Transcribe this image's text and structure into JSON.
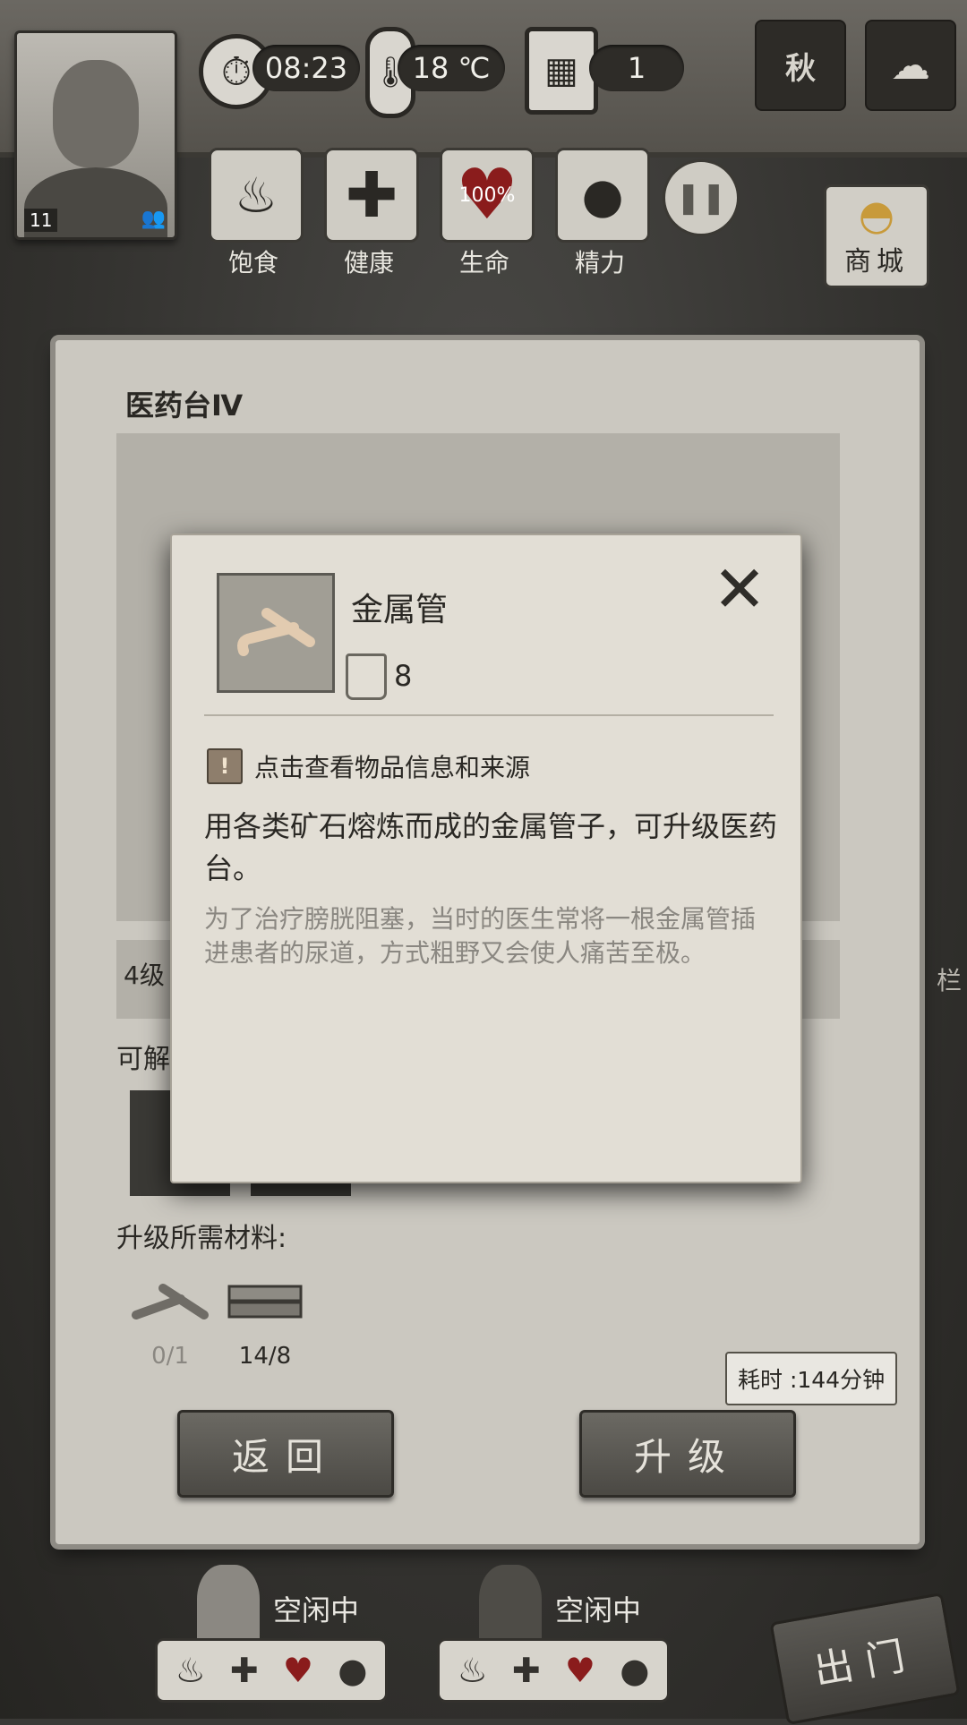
{
  "header": {
    "time": "08:23",
    "temperature": "18 ℃",
    "day": "1",
    "season": "秋",
    "portrait_level": "11"
  },
  "stats": [
    {
      "label": "饱食",
      "value": ""
    },
    {
      "label": "健康",
      "value": ""
    },
    {
      "label": "生命",
      "value": "100%"
    },
    {
      "label": "精力",
      "value": ""
    }
  ],
  "shop": {
    "label": "商城"
  },
  "panel": {
    "title": "医药台Ⅳ",
    "level_row": "4级",
    "unlock_label": "可解",
    "requirements_label": "升级所需材料:",
    "materials": [
      {
        "icon": "metal-pipe-icon",
        "qty": "0/1",
        "qty_color": "#8a8781"
      },
      {
        "icon": "wood-plank-icon",
        "qty": "14/8",
        "qty_color": "#2a2824"
      }
    ],
    "back_button": "返回",
    "upgrade_button": "升级",
    "time_cost": "耗时 :144分钟"
  },
  "dialog": {
    "item_name": "金属管",
    "item_count": "8",
    "info_link": "点击查看物品信息和来源",
    "description": "用各类矿石熔炼而成的金属管子，可升级医药台。",
    "lore": "为了治疗膀胱阻塞，当时的医生常将一根金属管插进患者的尿道，方式粗野又会使人痛苦至极。"
  },
  "companions": [
    {
      "status": "空闲中"
    },
    {
      "status": "空闲中"
    }
  ],
  "exit_button": "出门",
  "side_label": "栏"
}
